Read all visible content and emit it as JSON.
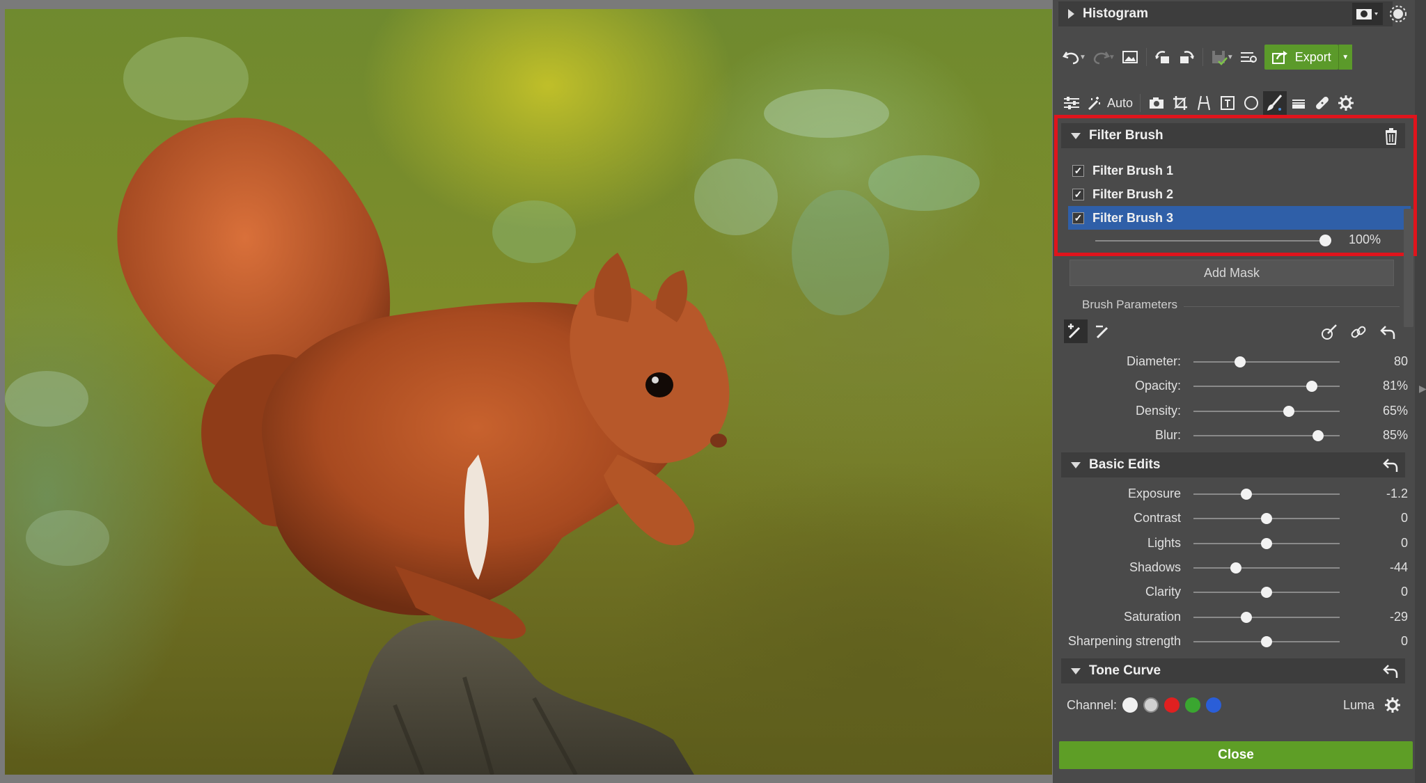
{
  "histogram": {
    "title": "Histogram"
  },
  "toolbar": {
    "export_label": "Export",
    "auto_label": "Auto"
  },
  "filter_brush": {
    "title": "Filter Brush",
    "items": [
      {
        "label": "Filter Brush 1",
        "checked": true
      },
      {
        "label": "Filter Brush 2",
        "checked": true
      },
      {
        "label": "Filter Brush 3",
        "checked": true
      }
    ],
    "strength": {
      "value": "100%",
      "level": 1.0
    },
    "add_mask_label": "Add Mask"
  },
  "brush_parameters": {
    "title": "Brush Parameters",
    "sliders": [
      {
        "label": "Diameter:",
        "value": "80",
        "level": 0.32
      },
      {
        "label": "Opacity:",
        "value": "81%",
        "level": 0.81
      },
      {
        "label": "Density:",
        "value": "65%",
        "level": 0.65
      },
      {
        "label": "Blur:",
        "value": "85%",
        "level": 0.85
      }
    ]
  },
  "basic_edits": {
    "title": "Basic Edits",
    "sliders": [
      {
        "label": "Exposure",
        "value": "-1.2",
        "level": 0.36
      },
      {
        "label": "Contrast",
        "value": "0",
        "level": 0.5
      },
      {
        "label": "Lights",
        "value": "0",
        "level": 0.5
      },
      {
        "label": "Shadows",
        "value": "-44",
        "level": 0.29
      },
      {
        "label": "Clarity",
        "value": "0",
        "level": 0.5
      },
      {
        "label": "Saturation",
        "value": "-29",
        "level": 0.36
      },
      {
        "label": "Sharpening strength",
        "value": "0",
        "level": 0.5
      }
    ]
  },
  "tone_curve": {
    "title": "Tone Curve",
    "channel_label": "Channel:",
    "mode_label": "Luma",
    "channel_colors": [
      "#f0f0f0",
      "#d0d0d0",
      "#e02020",
      "#3aa630",
      "#2a5ed8"
    ]
  },
  "close_label": "Close"
}
